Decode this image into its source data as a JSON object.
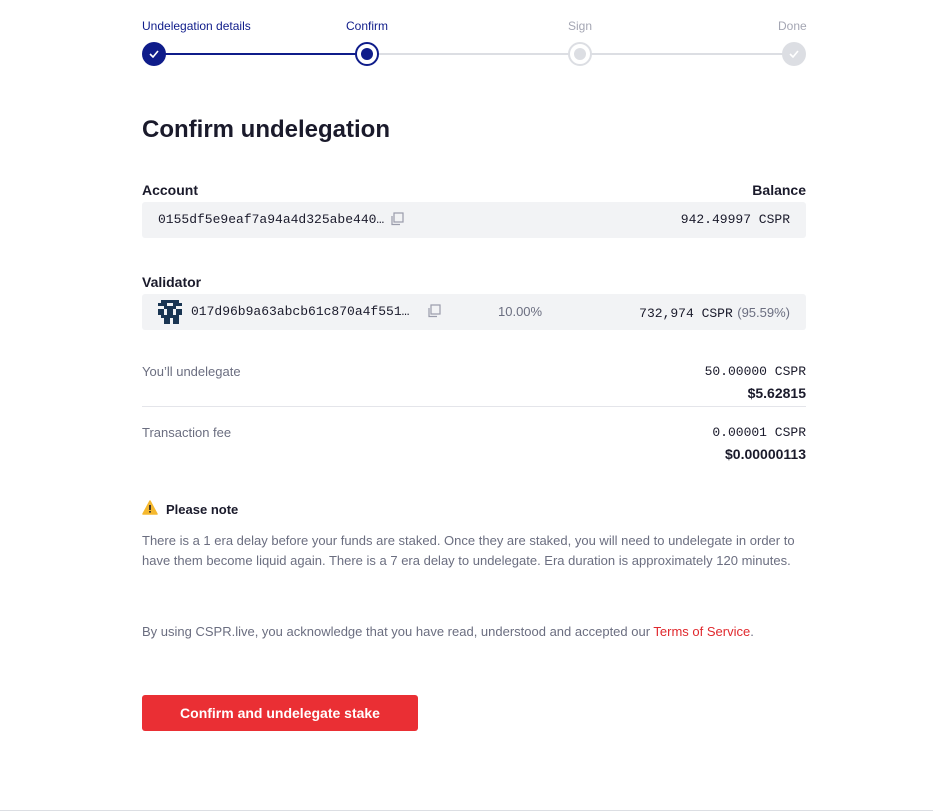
{
  "stepper": {
    "steps": [
      {
        "label": "Undelegation details",
        "state": "complete"
      },
      {
        "label": "Confirm",
        "state": "current"
      },
      {
        "label": "Sign",
        "state": "pending"
      },
      {
        "label": "Done",
        "state": "pending"
      }
    ]
  },
  "page_title": "Confirm undelegation",
  "account": {
    "label": "Account",
    "balance_label": "Balance",
    "key": "0155df5e9eaf7a94a4d325abe440…",
    "balance": "942.49997 CSPR"
  },
  "validator": {
    "label": "Validator",
    "key": "017d96b9a63abcb61c870a4f551…",
    "fee": "10.00%",
    "stake": "732,974 CSPR",
    "stake_pct": "(95.59%)"
  },
  "undelegate": {
    "label": "You’ll undelegate",
    "amount": "50.00000 CSPR",
    "usd": "$5.62815"
  },
  "fee": {
    "label": "Transaction fee",
    "amount": "0.00001 CSPR",
    "usd": "$0.00000113"
  },
  "note": {
    "title": "Please note",
    "text": "There is a 1 era delay before your funds are staked. Once they are staked, you will need to undelegate in order to have them become liquid again. There is a 7 era delay to undelegate. Era duration is approximately 120 minutes."
  },
  "tos": {
    "prefix": "By using CSPR.live, you acknowledge that you have read, understood and accepted our ",
    "link": "Terms of Service",
    "suffix": "."
  },
  "confirm_button": "Confirm and undelegate stake",
  "colors": {
    "primary": "#0f1c8a",
    "accent": "#ea2f34",
    "warning": "#f5b82e"
  },
  "icons": {
    "step_complete": "check-icon",
    "copy": "copy-icon",
    "warning": "warning-triangle-icon",
    "validator_avatar": "validator-avatar-icon"
  }
}
